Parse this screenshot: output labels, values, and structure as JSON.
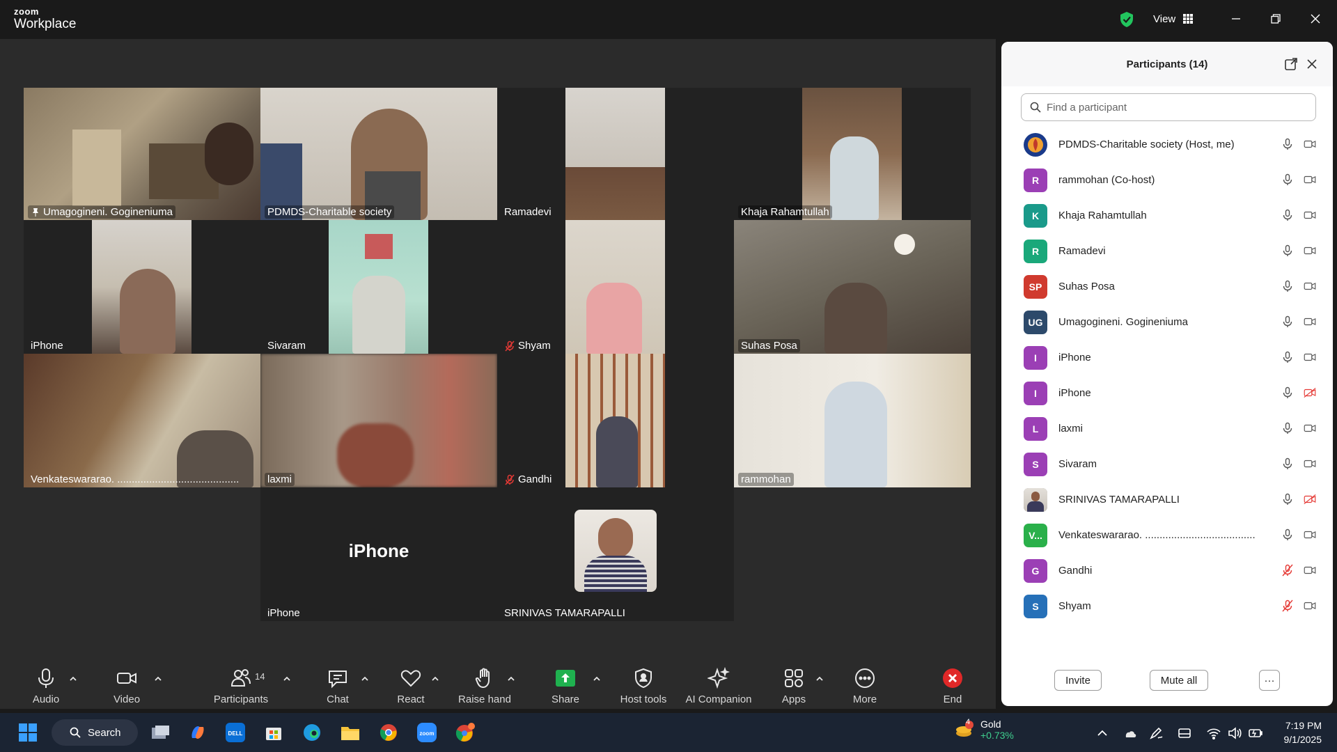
{
  "app": {
    "logo_small": "zoom",
    "logo_big": "Workplace",
    "view_label": "View"
  },
  "tiles": [
    {
      "name": "Umagogineni. Gogineniuma",
      "pinned": true,
      "active": true
    },
    {
      "name": "PDMDS-Charitable society"
    },
    {
      "name": "Ramadevi"
    },
    {
      "name": "Khaja Rahamtullah"
    },
    {
      "name": "iPhone"
    },
    {
      "name": "Sivaram"
    },
    {
      "name": "Shyam",
      "muted": true
    },
    {
      "name": "Suhas Posa"
    },
    {
      "name": "Venkateswararao.       .........................................."
    },
    {
      "name": "laxmi"
    },
    {
      "name": "Gandhi",
      "muted": true
    },
    {
      "name": "rammohan"
    },
    {
      "name": "iPhone",
      "big_name": "iPhone"
    },
    {
      "name": "SRINIVAS TAMARAPALLI"
    }
  ],
  "panel": {
    "title": "Participants (14)",
    "search_placeholder": "Find a participant",
    "participants": [
      {
        "name": "PDMDS-Charitable society (Host, me)",
        "avatar": "",
        "color": "#1a3a8a",
        "mic_muted": false,
        "video_off": false
      },
      {
        "name": "rammohan (Co-host)",
        "avatar": "R",
        "color": "#9b3fb5",
        "mic_muted": false,
        "video_off": false
      },
      {
        "name": "Khaja Rahamtullah",
        "avatar": "K",
        "color": "#1a9a8a",
        "mic_muted": false,
        "video_off": false
      },
      {
        "name": "Ramadevi",
        "avatar": "R",
        "color": "#1aa87a",
        "mic_muted": false,
        "video_off": false
      },
      {
        "name": "Suhas Posa",
        "avatar": "SP",
        "color": "#d03a2e",
        "mic_muted": false,
        "video_off": false
      },
      {
        "name": "Umagogineni. Gogineniuma",
        "avatar": "UG",
        "color": "#2d4a6b",
        "mic_muted": false,
        "video_off": false
      },
      {
        "name": "iPhone",
        "avatar": "I",
        "color": "#9b3fb5",
        "mic_muted": false,
        "video_off": false
      },
      {
        "name": "iPhone",
        "avatar": "I",
        "color": "#9b3fb5",
        "mic_muted": false,
        "video_off": true
      },
      {
        "name": "laxmi",
        "avatar": "L",
        "color": "#9b3fb5",
        "mic_muted": false,
        "video_off": false
      },
      {
        "name": "Sivaram",
        "avatar": "S",
        "color": "#9b3fb5",
        "mic_muted": false,
        "video_off": false
      },
      {
        "name": "SRINIVAS TAMARAPALLI",
        "avatar": "",
        "color": "#8a8a8a",
        "mic_muted": false,
        "video_off": true
      },
      {
        "name": "Venkateswararao.       ......................................",
        "avatar": "V...",
        "color": "#2ab04a",
        "mic_muted": false,
        "video_off": false
      },
      {
        "name": "Gandhi",
        "avatar": "G",
        "color": "#9b3fb5",
        "mic_muted": true,
        "video_off": false
      },
      {
        "name": "Shyam",
        "avatar": "S",
        "color": "#2670b8",
        "mic_muted": true,
        "video_off": false
      }
    ],
    "invite_label": "Invite",
    "mute_all_label": "Mute all",
    "more_label": "···"
  },
  "toolbar": {
    "audio": "Audio",
    "video": "Video",
    "participants": "Participants",
    "participants_count": "14",
    "chat": "Chat",
    "react": "React",
    "raise_hand": "Raise hand",
    "share": "Share",
    "host_tools": "Host tools",
    "ai_companion": "AI Companion",
    "apps": "Apps",
    "more": "More",
    "end": "End"
  },
  "taskbar": {
    "search": "Search",
    "gold_label": "Gold",
    "gold_change": "+0.73%",
    "gold_badge": "4",
    "time": "7:19 PM",
    "date": "9/1/2025"
  },
  "colors": {
    "accent_green": "#2bd47c",
    "share_green": "#1fb14f",
    "end_red": "#e02828",
    "muted_red": "#e53935"
  }
}
